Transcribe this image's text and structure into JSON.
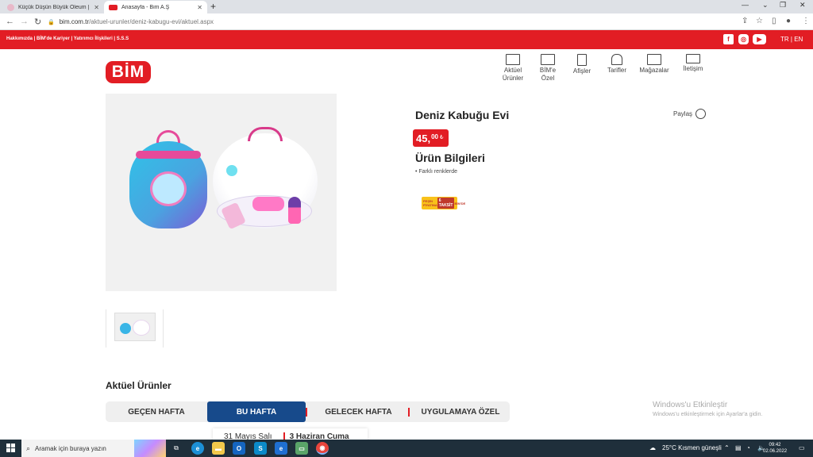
{
  "browser": {
    "tabs": [
      {
        "title": "Küçük Düşün Büyük Oleum | Pep",
        "active": false
      },
      {
        "title": "Anasayfa - Bim A.Ş",
        "active": true
      }
    ],
    "url_host": "bim.com.tr",
    "url_path": "/aktuel-urunler/deniz-kabugu-evi/aktuel.aspx"
  },
  "topbar": {
    "links": "Hakkımızda | BİM'de Kariyer | Yatırımcı İlişkileri | S.S.S",
    "lang": "TR | EN",
    "social": [
      "facebook-icon",
      "instagram-icon",
      "youtube-icon"
    ]
  },
  "header": {
    "logo_text": "BİM",
    "nav": [
      {
        "label": "Aktüel Ürünler",
        "line1": "Aktüel",
        "line2": "Ürünler",
        "icon": "catalog-icon"
      },
      {
        "label": "BİM'e Özel",
        "line1": "BİM'e",
        "line2": "Özel",
        "icon": "bim-special-icon"
      },
      {
        "label": "Afişler",
        "line1": "Afişler",
        "line2": "",
        "icon": "poster-icon"
      },
      {
        "label": "Tarifler",
        "line1": "Tarifler",
        "line2": "",
        "icon": "chef-hat-icon"
      },
      {
        "label": "Mağazalar",
        "line1": "Mağazalar",
        "line2": "",
        "icon": "store-icon"
      },
      {
        "label": "İletişim",
        "line1": "İletişim",
        "line2": "",
        "icon": "mail-icon"
      }
    ]
  },
  "product": {
    "title": "Deniz Kabuğu Evi",
    "price_whole": "45,",
    "price_fraction": "00",
    "currency": "₺",
    "share_label": "Paylaş",
    "info_heading": "Ürün Bilgileri",
    "info_items": [
      "• Farklı renklerde"
    ],
    "badge": {
      "top": "PEŞİN FİYATINA",
      "main": "6 TAKSİT",
      "bottom": "BİM'DE"
    }
  },
  "aktuel": {
    "title": "Aktüel Ürünler",
    "tabs": [
      "GEÇEN HAFTA",
      "BU HAFTA",
      "GELECEK HAFTA",
      "UYGULAMAYA ÖZEL"
    ],
    "active_tab": "BU HAFTA",
    "dates": [
      "31 Mayıs Salı",
      "3 Haziran Cuma"
    ]
  },
  "watermark": {
    "line1": "Windows'u Etkinleştir",
    "line2": "Windows'u etkinleştirmek için Ayarlar'a gidin."
  },
  "taskbar": {
    "search_placeholder": "Aramak için buraya yazın",
    "weather": "25°C  Kısmen güneşli",
    "time": "09:42",
    "date": "02.06.2022"
  },
  "colors": {
    "brand_red": "#e21d24",
    "active_tab_blue": "#174a8b"
  }
}
